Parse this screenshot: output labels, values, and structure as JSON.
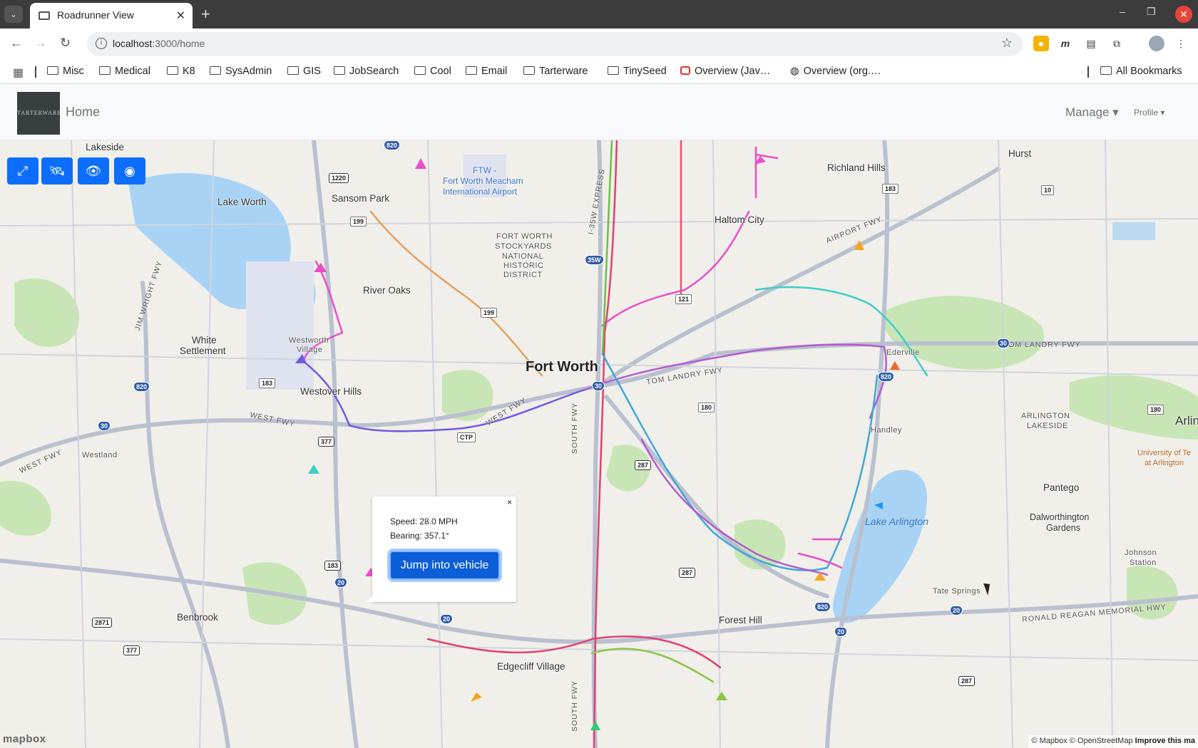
{
  "browser": {
    "tab_title": "Roadrunner View",
    "tab_close": "✕",
    "new_tab": "+",
    "url_host": "localhost",
    "url_path": ":3000/home",
    "window": {
      "minimize": "–",
      "restore": "❐",
      "close": "✕"
    },
    "bookmarks": [
      "Misc",
      "Medical",
      "K8",
      "SysAdmin",
      "GIS",
      "JobSearch",
      "Cool",
      "Email",
      "Tarterware",
      "TinySeed",
      "Overview (Jav…",
      "Overview (org.…"
    ],
    "all_bookmarks": "All Bookmarks"
  },
  "app": {
    "logo_text": "TARTERWARE",
    "home_label": "Home",
    "manage_label": "Manage ▾",
    "profile_label": "Profile ▾"
  },
  "map_controls": [
    {
      "icon": "fullscreen-icon",
      "glyph": "⤢"
    },
    {
      "icon": "satellite-icon",
      "glyph": "🛰"
    },
    {
      "icon": "eye-icon",
      "glyph": "👁"
    },
    {
      "icon": "eye-slash-icon",
      "glyph": "◉"
    }
  ],
  "popup": {
    "close": "×",
    "speed": "Speed: 28.0 MPH",
    "bearing": "Bearing: 357.1°",
    "button": "Jump into vehicle"
  },
  "map_labels": {
    "city": "Fort Worth",
    "lakeside": "Lakeside",
    "lake_worth": "Lake Worth",
    "sansom_park": "Sansom Park",
    "airport_code": "FTW -",
    "airport_name": "Fort Worth Meacham",
    "airport_name2": "International Airport",
    "stockyards": "FORT WORTH",
    "stockyards2": "STOCKYARDS",
    "stockyards3": "NATIONAL",
    "stockyards4": "HISTORIC",
    "stockyards5": "DISTRICT",
    "richland_hills": "Richland Hills",
    "hurst": "Hurst",
    "haltom_city": "Haltom City",
    "river_oaks": "River Oaks",
    "white_settlement": "White",
    "white_settlement2": "Settlement",
    "westworth": "Westworth",
    "westworth2": "Village",
    "westover_hills": "Westover Hills",
    "westland": "Westland",
    "ederville": "Ederville",
    "handley": "Handley",
    "arlington_lakeside": "ARLINGTON",
    "arlington_lakeside2": "LAKESIDE",
    "arlin": "Arlin",
    "ut_arlington": "University of Te",
    "ut_arlington2": "at Arlington",
    "pantego": "Pantego",
    "lake_arlington": "Lake Arlington",
    "dalworthington": "Dalworthington",
    "dalworthington2": "Gardens",
    "johnson_station": "Johnson",
    "johnson_station2": "Station",
    "tate_springs": "Tate Springs",
    "benbrook": "Benbrook",
    "forest_hill": "Forest Hill",
    "edgecliff": "Edgecliff Village",
    "jim_wright": "JIM WRIGHT FWY",
    "west_fwy1": "WEST FWY",
    "west_fwy2": "WEST FWY",
    "west_fwy3": "WEST FWY",
    "tom_landry1": "TOM LANDRY FWY",
    "tom_landry2": "TOM LANDRY FWY",
    "airport_fwy": "AIRPORT FWY",
    "i35w_express": "I-35W EXPRESS",
    "south_fwy1": "SOUTH FWY",
    "south_fwy2": "SOUTH FWY",
    "reagan_hwy": "RONALD REAGAN MEMORIAL HWY"
  },
  "attribution": {
    "text": "© Mapbox © OpenStreetMap",
    "improve": "Improve this ma",
    "mapbox_logo": "mapbox"
  },
  "colors": {
    "control_blue": "#0d6efd",
    "water": "#a9d3f5",
    "park": "#c8e6b5"
  }
}
